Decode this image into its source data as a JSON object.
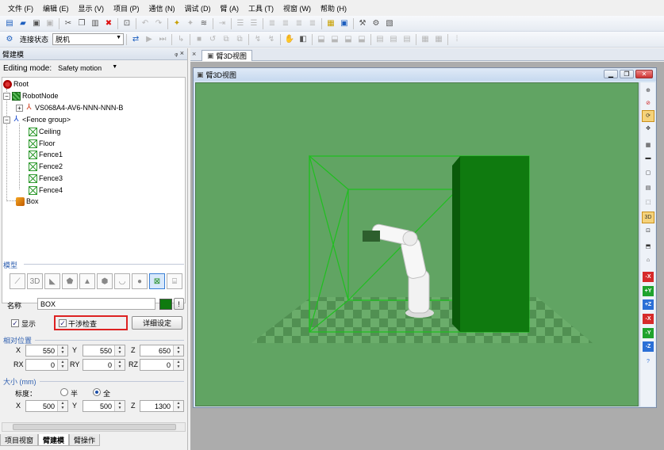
{
  "menu": [
    "文件 (F)",
    "编辑 (E)",
    "显示 (V)",
    "项目 (P)",
    "通信 (N)",
    "调试 (D)",
    "臂 (A)",
    "工具 (T)",
    "视窗 (W)",
    "帮助 (H)"
  ],
  "toolbar": {
    "connection_label": "连接状态",
    "connection_value": "脱机"
  },
  "panel": {
    "title": "臂建模",
    "pin": "ᵩ ×",
    "editing_mode_label": "Editing mode:",
    "editing_mode_value": "Safety motion"
  },
  "tree": {
    "root": "Root",
    "robot_node": "RobotNode",
    "robot": "VS068A4-AV6-NNN-NNN-B",
    "fence_group": "<Fence group>",
    "children": [
      "Ceiling",
      "Floor",
      "Fence1",
      "Fence2",
      "Fence3",
      "Fence4"
    ],
    "box": "Box"
  },
  "model": {
    "section_title": "模型",
    "name_label": "名称",
    "name_value": "BOX",
    "color_btn": "!",
    "display_label": "显示",
    "interference_label": "干涉检查",
    "detail_button": "详细设定",
    "colors": {
      "box": "#0f7a0f",
      "fence": "#1fbf1f",
      "floor": "#61a463"
    }
  },
  "position": {
    "section_title": "相对位置",
    "x_label": "X",
    "x": "550",
    "y_label": "Y",
    "y": "550",
    "z_label": "Z",
    "z": "650",
    "rx_label": "RX",
    "rx": "0",
    "ry_label": "RY",
    "ry": "0",
    "rz_label": "RZ",
    "rz": "0"
  },
  "size": {
    "section_title": "大小 (mm)",
    "mode_label": "标度：",
    "half": "半",
    "full": "全",
    "x_label": "X",
    "x": "500",
    "y_label": "Y",
    "y": "500",
    "z_label": "Z",
    "z": "1300"
  },
  "bottom_tabs": [
    "项目视窗",
    "臂建模",
    "臂操作"
  ],
  "view": {
    "tab": "臂3D视图",
    "window_title": "臂3D视图"
  },
  "view_tools": [
    "⊕",
    "⊘",
    "⟳",
    "✥",
    "▦",
    "▬",
    "▢",
    "▤",
    "⬚",
    "3D",
    "⊡",
    "⬒",
    "⌂",
    "-X",
    "+Y",
    "+Z",
    "-X",
    "-Y",
    "-Z",
    "?"
  ]
}
